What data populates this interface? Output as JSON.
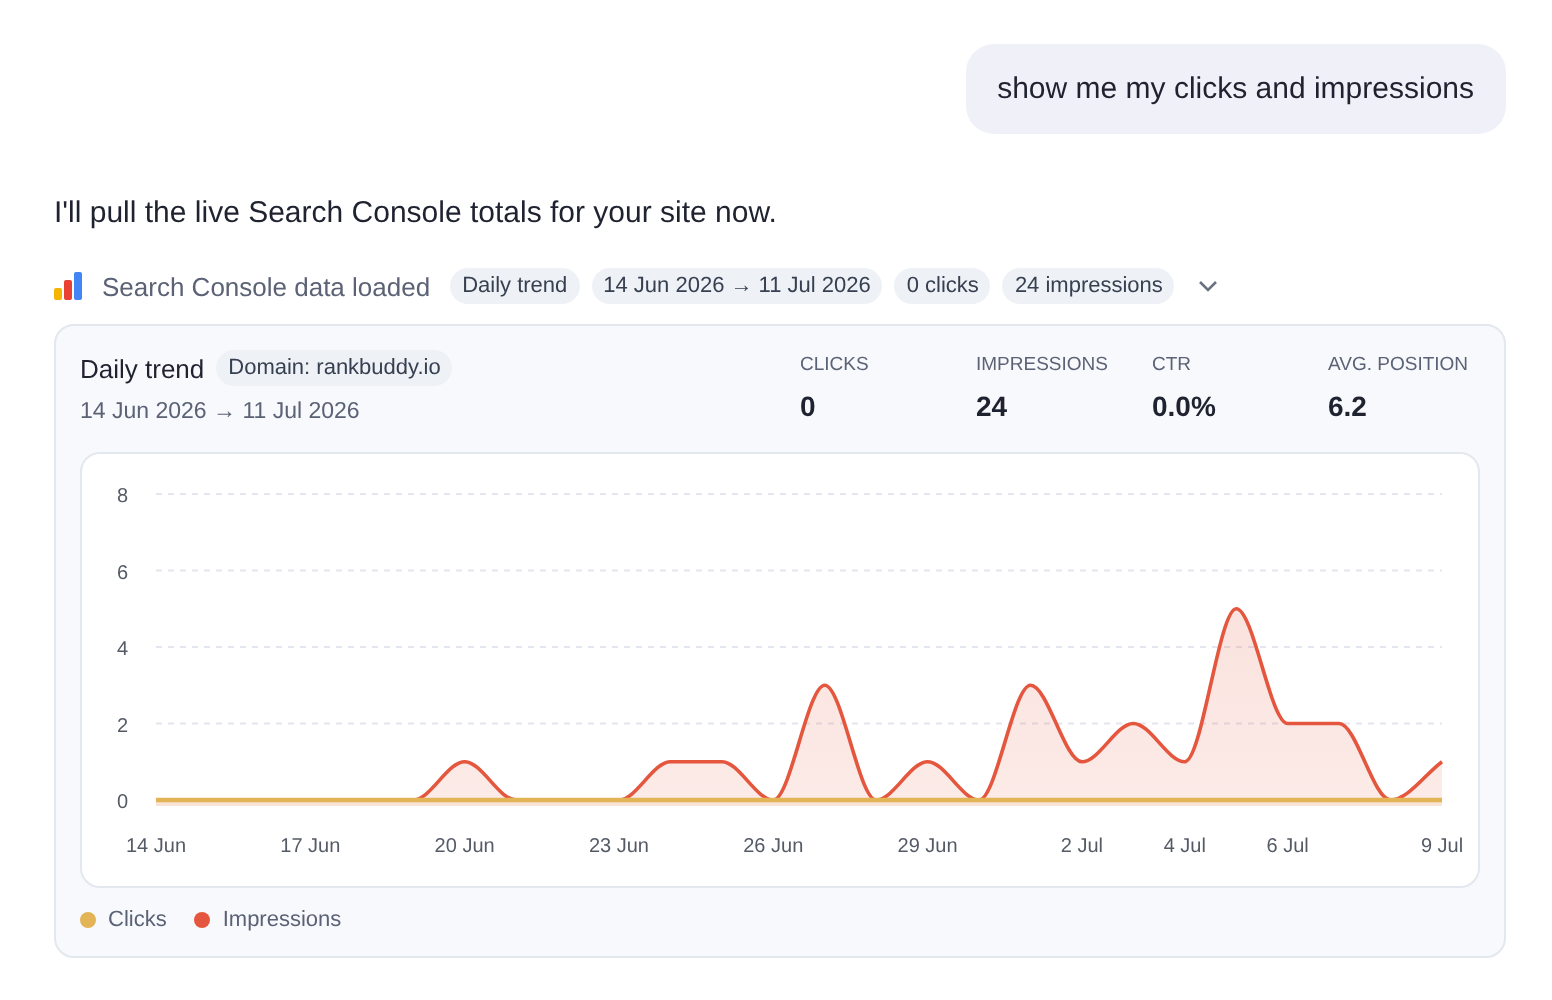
{
  "user_message": "show me my clicks and impressions",
  "assistant_message": "I'll pull the live Search Console totals for your site now.",
  "tool_status": {
    "label": "Search Console data loaded",
    "chips": [
      "Daily trend",
      "14 Jun 2026 → 11 Jul 2026",
      "0 clicks",
      "24 impressions"
    ],
    "expanded": false
  },
  "card": {
    "title": "Daily trend",
    "domain": "Domain: rankbuddy.io",
    "range": "14 Jun 2026 → 11 Jul 2026",
    "metrics": [
      {
        "label": "CLICKS",
        "value": "0"
      },
      {
        "label": "IMPRESSIONS",
        "value": "24"
      },
      {
        "label": "CTR",
        "value": "0.0%"
      },
      {
        "label": "AVG. POSITION",
        "value": "6.2"
      }
    ],
    "chart_data": {
      "type": "area",
      "grid": true,
      "categories": [
        "14 Jun",
        null,
        null,
        "17 Jun",
        null,
        null,
        "20 Jun",
        null,
        null,
        "23 Jun",
        null,
        null,
        "26 Jun",
        null,
        null,
        "29 Jun",
        null,
        null,
        "2 Jul",
        null,
        "4 Jul",
        null,
        "6 Jul",
        null,
        null,
        "9 Jul"
      ],
      "series": [
        {
          "name": "Clicks",
          "color": "#e2b456",
          "values": [
            0,
            0,
            0,
            0,
            0,
            0,
            0,
            0,
            0,
            0,
            0,
            0,
            0,
            0,
            0,
            0,
            0,
            0,
            0,
            0,
            0,
            0,
            0,
            0,
            0,
            0
          ]
        },
        {
          "name": "Impressions",
          "color": "#e4573e",
          "values": [
            0,
            0,
            0,
            0,
            0,
            0,
            1,
            0,
            0,
            0,
            1,
            1,
            0,
            3,
            0,
            1,
            0,
            3,
            1,
            2,
            1,
            5,
            2,
            2,
            0,
            1
          ]
        }
      ],
      "ylim": [
        0,
        8
      ],
      "yticks": [
        0,
        2,
        4,
        6,
        8
      ]
    }
  }
}
